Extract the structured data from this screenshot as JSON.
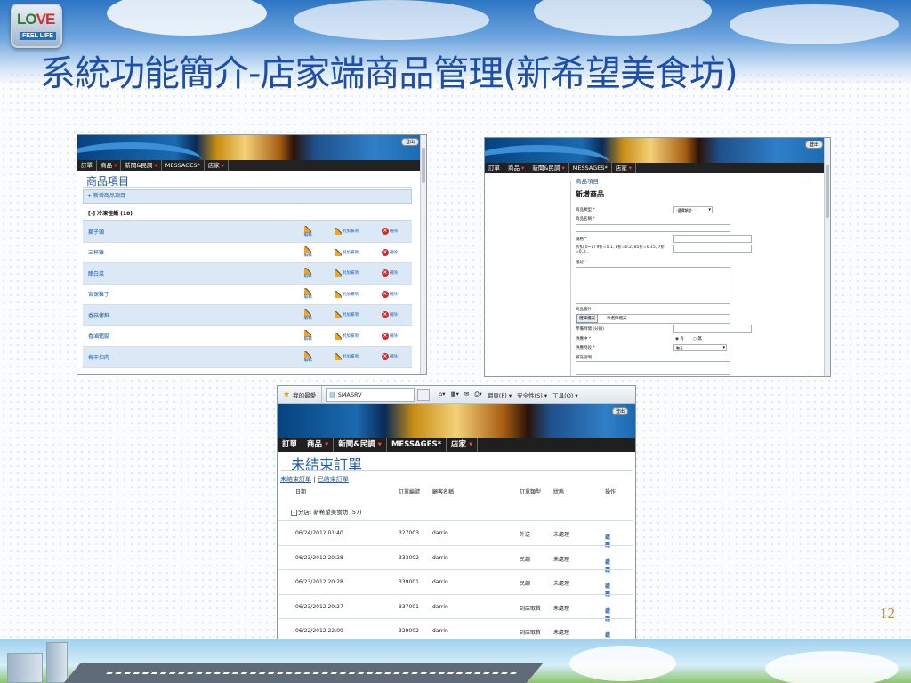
{
  "slide": {
    "title": "系統功能簡介-店家端商品管理(新希望美食坊)",
    "page_number": "12",
    "logo": {
      "line1_a": "LO",
      "line1_b": "VE",
      "line2": "FEEL LIFE"
    }
  },
  "shot1": {
    "banner_button": "登出",
    "menu": [
      "訂單",
      "商品",
      "新聞&民調",
      "MESSAGES*",
      "店家"
    ],
    "page_title": "商品項目",
    "add_link": "+ 新增商品項目",
    "category": "[-] 冷凍佳餚 (18)",
    "actions": {
      "edit": "編輯",
      "addon": "附加備項",
      "delete": "刪除"
    },
    "items": [
      "獅子頭",
      "三杯雞",
      "醋白菜",
      "宮保雞丁",
      "香菇烤麩",
      "香滷豬腳",
      "梅干扣肉"
    ]
  },
  "shot2": {
    "banner_button": "登出",
    "menu": [
      "訂單",
      "商品",
      "新聞&民調",
      "MESSAGES*",
      "店家"
    ],
    "legend": "商品項目",
    "heading": "新增商品",
    "fields": {
      "type_label": "商品類型 *",
      "type_value": "-選擇類型-",
      "name_label": "商品名稱 *",
      "price_label": "價格 *",
      "discount_label": "折扣(0~1) 9折=0.1, 8折=0.2, 85折=0.15, 7折=0.3...",
      "desc_label": "描述 *",
      "image_label": "商品圖片",
      "browse_button": "選擇檔案",
      "no_file": "未選擇檔案",
      "prep_label": "準備時間 (分鐘)",
      "supplying_label": "供應中 *",
      "radio_yes": "有",
      "radio_no": "無",
      "period_label": "供應時段 *",
      "period_value": "整天",
      "extra_label": "補充說明"
    }
  },
  "shot3": {
    "ie": {
      "favorites": "我的最愛",
      "tab_title": "SMASRV",
      "cmds": [
        "網頁(P) ▾",
        "安全性(S) ▾",
        "工具(O) ▾"
      ]
    },
    "banner_button": "登出",
    "menu": [
      "訂單",
      "商品",
      "新聞&民調",
      "MESSAGES*",
      "店家"
    ],
    "page_title": "未結束訂單",
    "link_open": "未結束訂單",
    "link_sep": " | ",
    "link_closed": "已結束訂單",
    "headers": {
      "date": "日期",
      "order_no": "訂單編號",
      "customer": "顧客名稱",
      "type": "訂單類型",
      "status": "狀態",
      "ops": "操作"
    },
    "group": "分店: 新希望美食坊 (57)",
    "group_toggle": "-",
    "op_view": "檢閱",
    "op_process": "處理",
    "orders": [
      {
        "date": "06/24/2012 01:40",
        "no": "327003",
        "customer": "darrin",
        "type": "外送",
        "status": "未處理"
      },
      {
        "date": "06/23/2012 20:28",
        "no": "333002",
        "customer": "darrin",
        "type": "民調",
        "status": "未處理"
      },
      {
        "date": "06/23/2012 20:28",
        "no": "339001",
        "customer": "darrin",
        "type": "民調",
        "status": "未處理"
      },
      {
        "date": "06/23/2012 20:27",
        "no": "337001",
        "customer": "darrin",
        "type": "到店取貨",
        "status": "未處理"
      },
      {
        "date": "06/22/2012 22:09",
        "no": "329002",
        "customer": "darrin",
        "type": "到店取貨",
        "status": "未處理"
      }
    ]
  }
}
